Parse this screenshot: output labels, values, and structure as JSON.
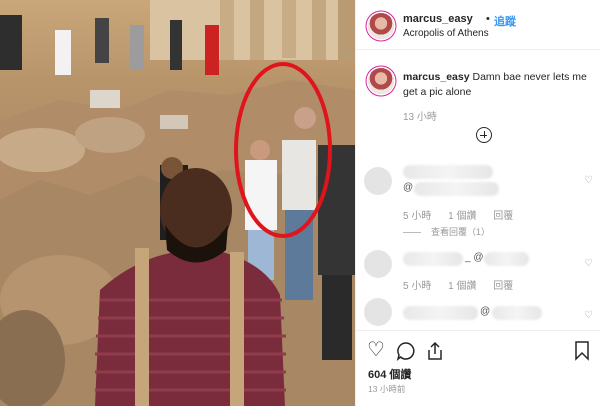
{
  "post": {
    "username": "marcus_easy",
    "dot": "•",
    "follow_label": "追蹤",
    "location": "Acropolis of Athens"
  },
  "caption": {
    "username": "marcus_easy",
    "text": "Damn bae never lets me get a pic alone",
    "time": "13 小時"
  },
  "comments": [
    {
      "tag": "@",
      "time": "5 小時",
      "likes": "1 個讚",
      "reply": "回覆",
      "view_replies": "查看回覆（1）"
    },
    {
      "tag": "_ @",
      "time": "5 小時",
      "likes": "1 個讚",
      "reply": "回覆"
    },
    {
      "tag": "@"
    }
  ],
  "actions": {
    "likes_count": "604",
    "likes_label": "個讚",
    "posted": "13 小時前"
  },
  "icons": [
    "heart-icon",
    "comment-icon",
    "share-icon",
    "bookmark-icon",
    "add-circle-icon"
  ],
  "colors": {
    "link": "#3897f0",
    "highlight_circle": "#e0141c"
  }
}
